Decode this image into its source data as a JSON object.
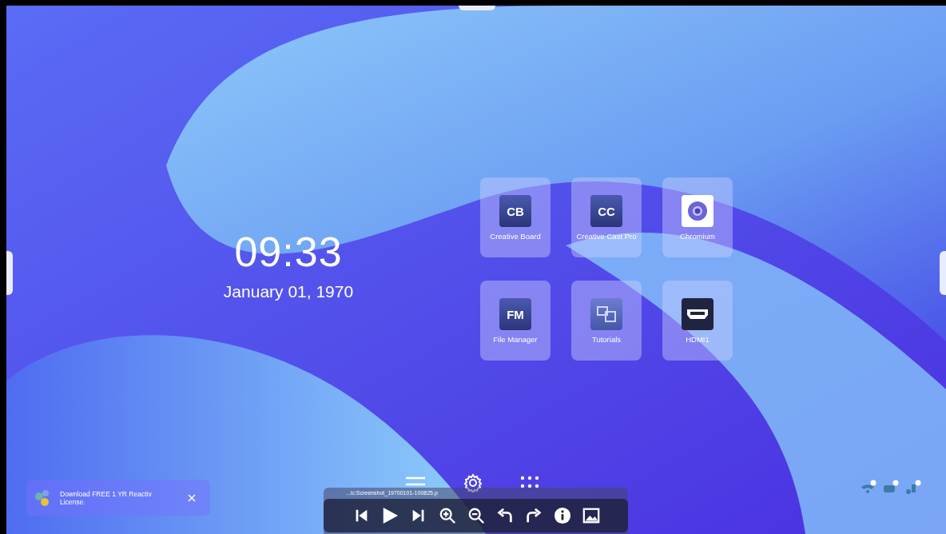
{
  "clock": {
    "time": "09:33",
    "date": "January 01, 1970"
  },
  "apps": [
    {
      "label": "Creative Board",
      "kind": "monogram",
      "badge": "CB"
    },
    {
      "label": "Creative Cast Pro",
      "kind": "monogram",
      "badge": "CC"
    },
    {
      "label": "Chromium",
      "kind": "browser"
    },
    {
      "label": "File Manager",
      "kind": "monogram",
      "badge": "FM"
    },
    {
      "label": "Tutorials",
      "kind": "tutorials"
    },
    {
      "label": "HDMI1",
      "kind": "hdmi"
    }
  ],
  "notification": {
    "text": "Download FREE 1 YR Reactiv License."
  },
  "viewer": {
    "filename": "...ic:Screenshot_19700101-100825.p"
  }
}
